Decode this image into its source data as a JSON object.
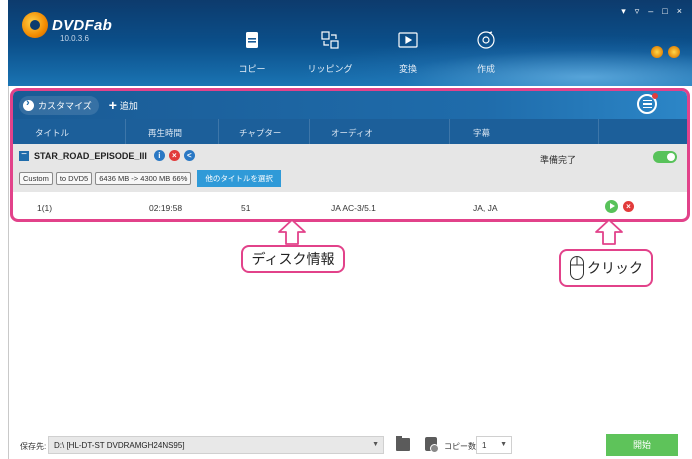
{
  "app": {
    "logo_text": "DVDFab",
    "version": "10.0.3.6",
    "window_controls": [
      "▾",
      "▿",
      "–",
      "□",
      "×"
    ]
  },
  "nav": {
    "items": [
      {
        "label": "コピー",
        "icon": "copy-icon"
      },
      {
        "label": "リッピング",
        "icon": "ripper-icon"
      },
      {
        "label": "変換",
        "icon": "convert-icon"
      },
      {
        "label": "作成",
        "icon": "creator-icon"
      }
    ]
  },
  "toolbar": {
    "customize_label": "カスタマイズ",
    "add_label": "追加"
  },
  "columns": [
    "タイトル",
    "再生時間",
    "チャプター",
    "オーディオ",
    "字幕"
  ],
  "disc": {
    "title": "STAR_ROAD_EPISODE_III",
    "status": "準備完了",
    "tags": [
      "Custom",
      "to DVD5",
      "6436 MB -> 4300 MB 66%"
    ],
    "select_title_button": "他のタイトルを選択"
  },
  "track": {
    "title": "1(1)",
    "duration": "02:19:58",
    "chapters": "51",
    "audio": "JA AC-3/5.1",
    "subtitles": "JA, JA"
  },
  "annotations": {
    "disc_info": "ディスク情報",
    "click": "クリック"
  },
  "footer": {
    "save_label": "保存先:",
    "save_path": "D:\\ [HL-DT-ST DVDRAMGH24NS95]",
    "copies_label": "コピー数:",
    "copies_value": "1",
    "start_label": "開始"
  },
  "colors": {
    "header_blue": "#0b4f8a",
    "highlight_pink": "#e2428a",
    "green": "#58c25a"
  }
}
